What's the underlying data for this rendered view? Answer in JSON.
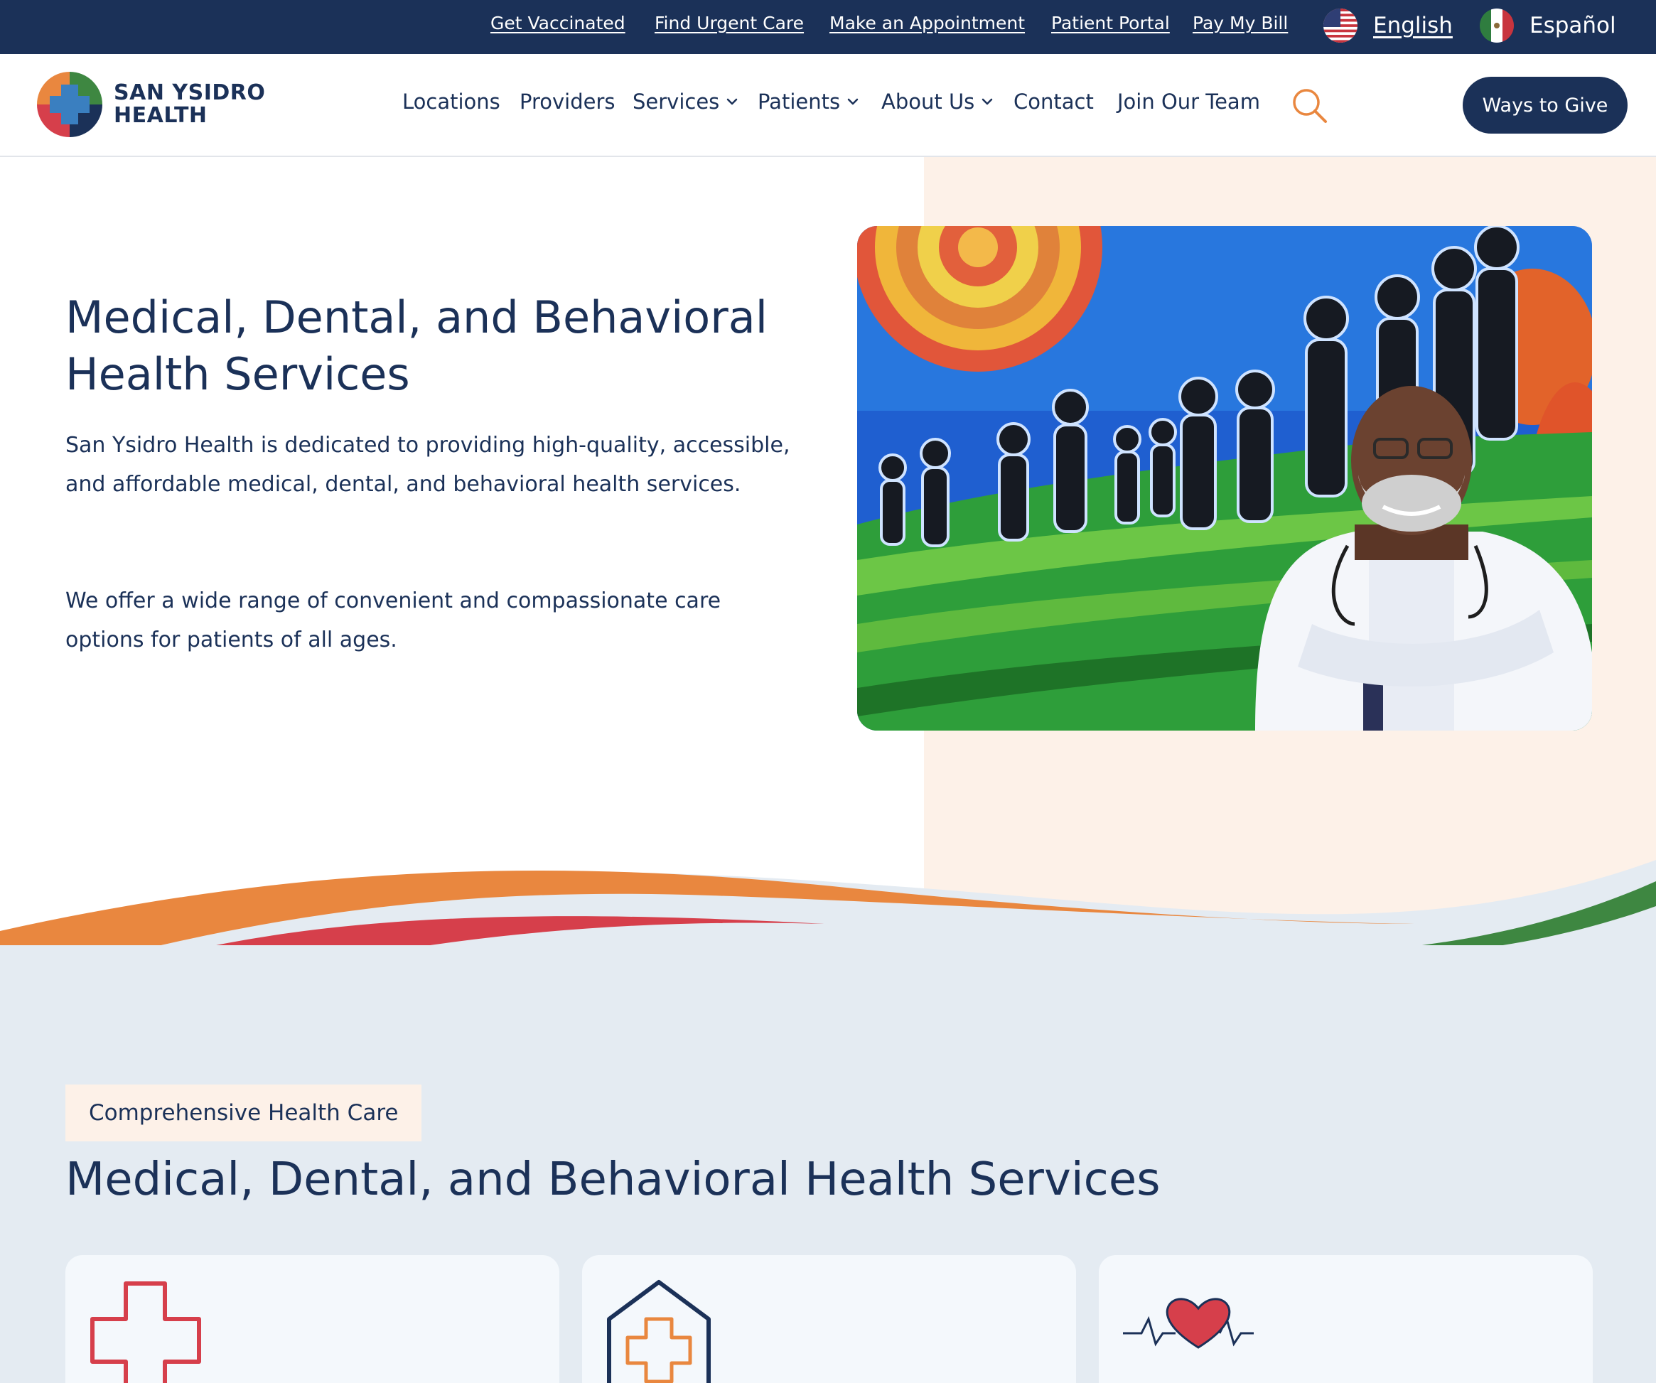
{
  "utility_nav": {
    "links": [
      "Get Vaccinated",
      "Find Urgent Care",
      "Make an Appointment",
      "Patient Portal",
      "Pay My Bill"
    ],
    "languages": [
      {
        "label": "English",
        "flag": "us-flag-icon",
        "active": true
      },
      {
        "label": "Español",
        "flag": "mexico-flag-icon",
        "active": false
      }
    ]
  },
  "brand": {
    "name_line1": "SAN YSIDRO",
    "name_line2": "HEALTH",
    "colors": {
      "navy": "#1b3158",
      "orange": "#e9873f",
      "red": "#d63f4b",
      "green": "#3e8741",
      "peach": "#fdf1e8",
      "light_blue": "#e4ebf2"
    }
  },
  "main_nav": {
    "items": [
      {
        "label": "Locations",
        "has_dropdown": false
      },
      {
        "label": "Providers",
        "has_dropdown": false
      },
      {
        "label": "Services",
        "has_dropdown": true
      },
      {
        "label": "Patients",
        "has_dropdown": true
      },
      {
        "label": "About Us",
        "has_dropdown": true
      },
      {
        "label": "Contact",
        "has_dropdown": false
      },
      {
        "label": "Join Our Team",
        "has_dropdown": false
      }
    ],
    "search_icon": "search-icon",
    "cta_label": "Ways to Give"
  },
  "hero": {
    "title": "Medical, Dental, and Behavioral Health Services",
    "paragraph1": "San Ysidro Health is dedicated to providing high-quality, accessible, and affordable medical, dental, and behavioral health services.",
    "paragraph2": "We offer a wide range of convenient and compassionate care options for patients of all ages."
  },
  "services": {
    "badge": "Comprehensive Health Care",
    "title": "Medical, Dental, and Behavioral Health Services",
    "cards": [
      {
        "icon": "medical-cross-icon"
      },
      {
        "icon": "clinic-stethoscope-icon"
      },
      {
        "icon": "heartbeat-icon"
      }
    ]
  }
}
